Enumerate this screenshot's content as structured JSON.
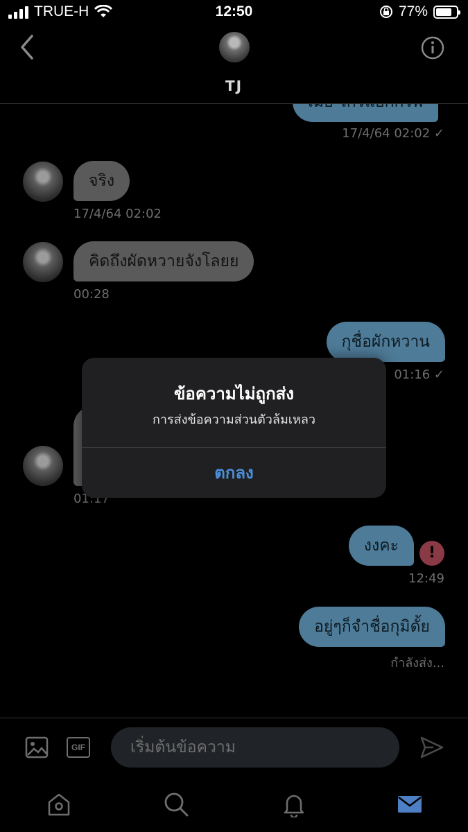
{
  "status_bar": {
    "carrier": "TRUE-H",
    "time": "12:50",
    "battery": "77%",
    "battery_level": 0.77
  },
  "header": {
    "name": "TJ"
  },
  "messages": [
    {
      "dir": "out",
      "text": "เมื่อ ไกรแอกกรีพ",
      "time": "17/4/64 02:02 ✓"
    },
    {
      "dir": "in",
      "text": "จริง",
      "time": "17/4/64 02:02"
    },
    {
      "dir": "in",
      "text": "คิดถึงผัดหวายจังโลยย",
      "time": "00:28"
    },
    {
      "dir": "out",
      "text": "กุชื่อผักหวาน",
      "time": "01:16 ✓"
    },
    {
      "dir": "in",
      "text": "",
      "time": "01:17"
    },
    {
      "dir": "out",
      "text": "งงคะ",
      "time": "12:49",
      "error": "!"
    },
    {
      "dir": "out",
      "text": "อยู่ๆก็จำชื่อกุมิดั้ย",
      "time": "กำลังส่ง..."
    }
  ],
  "alert": {
    "title": "ข้อความไม่ถูกส่ง",
    "message": "การส่งข้อความส่วนตัวล้มเหลว",
    "ok_label": "ตกลง"
  },
  "composer": {
    "placeholder": "เริ่มต้นข้อความ",
    "gif_label": "GIF"
  },
  "tabs": [
    "home-icon",
    "search-icon",
    "bell-icon",
    "mail-icon"
  ],
  "colors": {
    "accent": "#4a90d9",
    "out_bubble": "#4e7b98",
    "in_bubble": "#5a5a5a",
    "error": "#8a3a45"
  }
}
